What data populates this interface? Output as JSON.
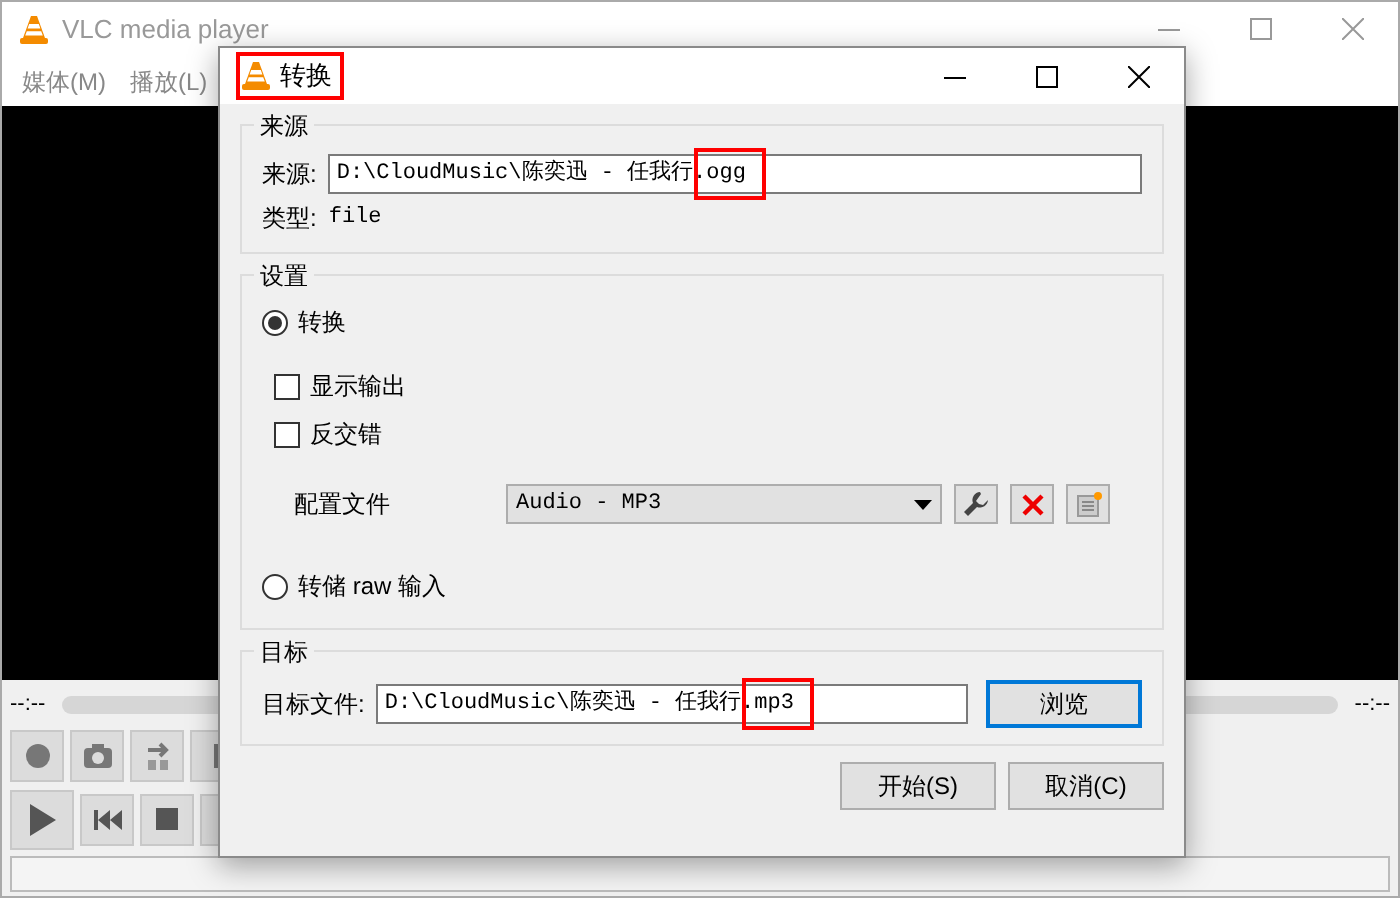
{
  "main_window": {
    "title": "VLC media player",
    "menu": [
      "媒体(M)",
      "播放(L)"
    ],
    "elapsed": "--:--",
    "remaining": "--:--"
  },
  "dialog": {
    "title": "转换",
    "title_highlighted": true,
    "source": {
      "heading": "来源",
      "label": "来源:",
      "value": "D:\\CloudMusic\\陈奕迅 - 任我行.ogg",
      "highlighted": true,
      "type_label": "类型:",
      "type_value": "file"
    },
    "settings": {
      "heading": "设置",
      "convert": {
        "label": "转换",
        "selected": true
      },
      "checkboxes": [
        {
          "label": "显示输出",
          "checked": false
        },
        {
          "label": "反交错",
          "checked": false
        }
      ],
      "profile": {
        "label": "配置文件",
        "value": "Audio - MP3"
      },
      "dump": {
        "label": "转储 raw 输入",
        "selected": false
      }
    },
    "target": {
      "heading": "目标",
      "label": "目标文件:",
      "value": "D:\\CloudMusic\\陈奕迅 - 任我行.mp3",
      "highlighted": true,
      "browse": {
        "label": "浏览",
        "focused": true
      }
    },
    "buttons": [
      {
        "label": "开始(S)"
      },
      {
        "label": "取消(C)"
      }
    ]
  }
}
